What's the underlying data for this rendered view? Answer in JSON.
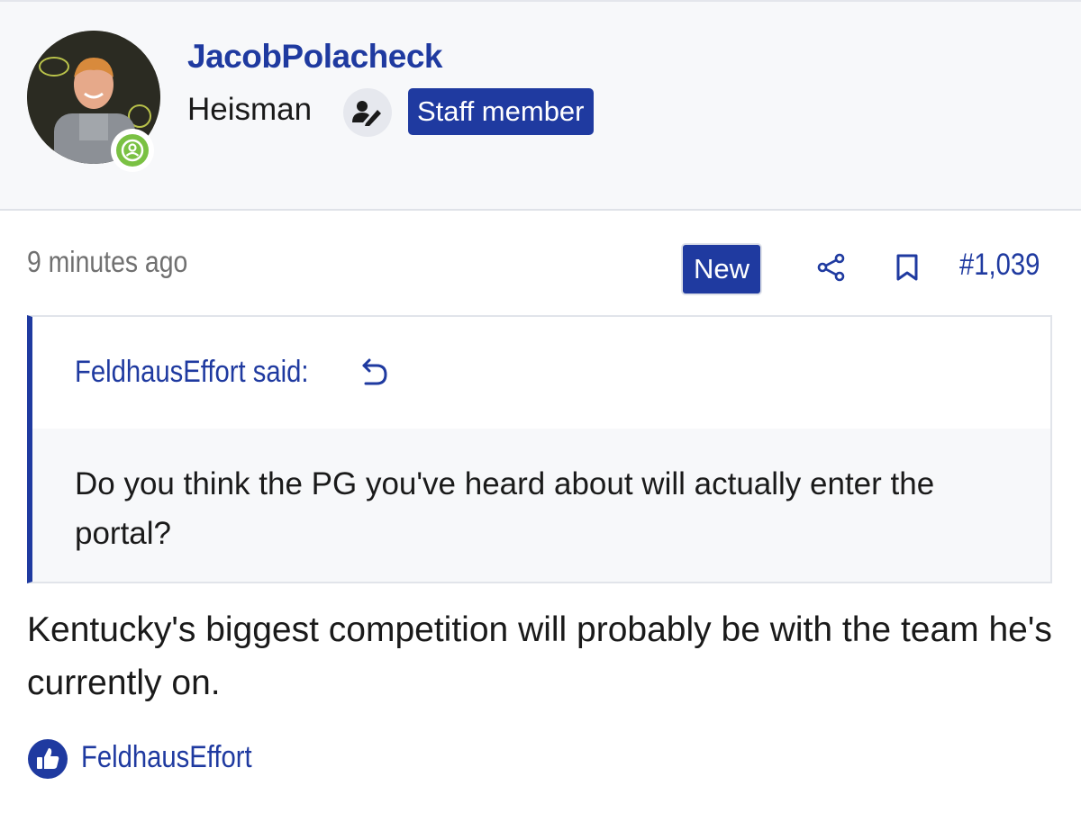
{
  "author": {
    "username": "JacobPolacheck",
    "user_title": "Heisman",
    "staff_badge": "Staff member"
  },
  "post": {
    "time": "9 minutes ago",
    "new_label": "New",
    "number": "#1,039",
    "text": "Kentucky's biggest competition will probably be with the team he's currently on."
  },
  "quote": {
    "attribution": "FeldhausEffort said:",
    "text": "Do you think the PG you've heard about will actually enter the portal?"
  },
  "reactions": {
    "users": "FeldhausEffort"
  },
  "colors": {
    "accent": "#1f3aa0",
    "header_bg": "#f7f8fa",
    "online_green": "#7ac143",
    "muted_text": "#707070"
  },
  "icons": {
    "staff": "user-edit-icon",
    "share": "share-icon",
    "bookmark": "bookmark-icon",
    "jump": "jump-to-quote-icon",
    "like": "thumbs-up-icon",
    "online": "online-status-icon"
  }
}
